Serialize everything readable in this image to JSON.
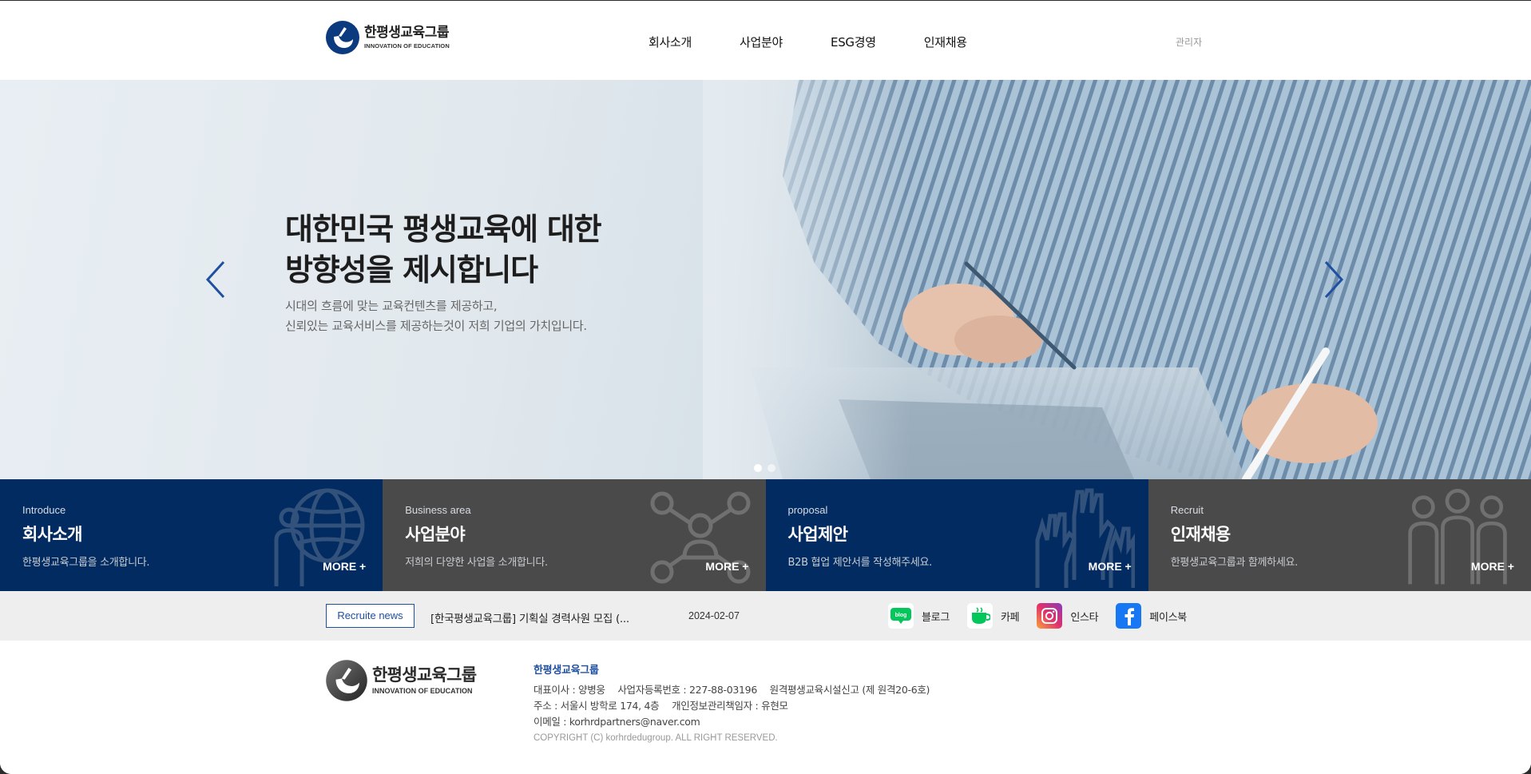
{
  "header": {
    "logo_ko": "한평생교육그룹",
    "logo_en": "INNOVATION OF EDUCATION",
    "nav": [
      "회사소개",
      "사업분야",
      "ESG경영",
      "인재채용"
    ],
    "admin": "관리자"
  },
  "hero": {
    "title_line1": "대한민국 평생교육에 대한",
    "title_line2": "방향성을 제시합니다",
    "sub_line1": "시대의 흐름에 맞는 교육컨텐츠를 제공하고,",
    "sub_line2": "신뢰있는 교육서비스를 제공하는것이 저희 기업의 가치입니다.",
    "slides_total": 2,
    "slide_active": 1
  },
  "quick_menu": [
    {
      "en": "Introduce",
      "title": "회사소개",
      "desc": "한평생교육그룹을 소개합니다.",
      "more": "MORE +",
      "icon": "person-globe-icon"
    },
    {
      "en": "Business area",
      "title": "사업분야",
      "desc": "저희의 다양한 사업을 소개합니다.",
      "more": "MORE +",
      "icon": "network-person-icon"
    },
    {
      "en": "proposal",
      "title": "사업제안",
      "desc": "B2B 협업 제안서를 작성해주세요.",
      "more": "MORE +",
      "icon": "raised-hands-icon"
    },
    {
      "en": "Recruit",
      "title": "인재채용",
      "desc": "한평생교육그룹과 함께하세요.",
      "more": "MORE +",
      "icon": "people-group-icon"
    }
  ],
  "news": {
    "badge": "Recruite news",
    "title": "[한국평생교육그룹] 기획실 경력사원 모집 (...",
    "date": "2024-02-07"
  },
  "sns": [
    {
      "label": "블로그",
      "icon": "blog-icon",
      "color": "#ffffff"
    },
    {
      "label": "카페",
      "icon": "cafe-icon",
      "color": "#ffffff"
    },
    {
      "label": "인스타",
      "icon": "instagram-icon",
      "color": "#d6297a"
    },
    {
      "label": "페이스북",
      "icon": "facebook-icon",
      "color": "#1877f2"
    }
  ],
  "footer": {
    "logo_ko": "한평생교육그룹",
    "logo_en": "INNOVATION OF EDUCATION",
    "company": "한평생교육그룹",
    "ceo": "대표이사 : 양병웅",
    "bizno": "사업자등록번호 : 227-88-03196",
    "facility": "원격평생교육시설신고 (제 원격20-6호)",
    "address": "주소 : 서울시 방학로 174, 4층",
    "privacy": "개인정보관리책임자 : 유현모",
    "email": "이메일 : korhrdpartners@naver.com",
    "copyright": "COPYRIGHT (C) korhrdedugroup. ALL RIGHT RESERVED."
  },
  "colors": {
    "navy": "#022c61",
    "gray": "#4a4a4a",
    "accent_blue": "#1f4fa0"
  }
}
